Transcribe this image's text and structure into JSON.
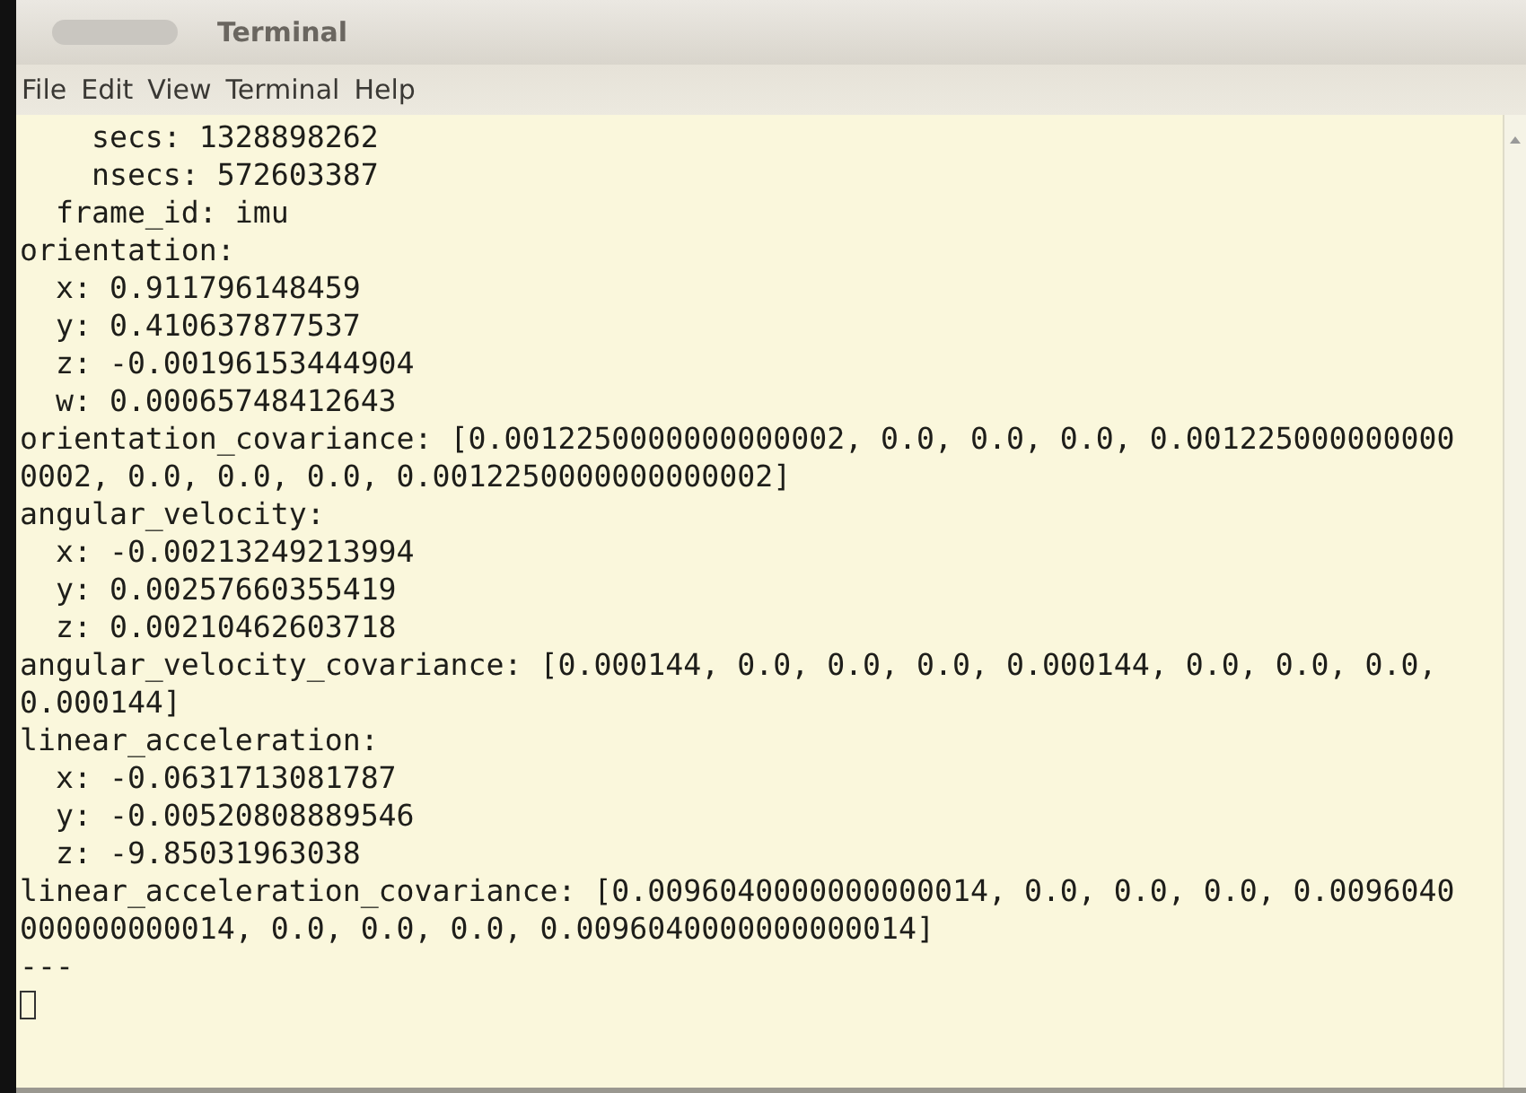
{
  "window": {
    "title": "Terminal"
  },
  "menu_bar": [
    "File",
    "Edit",
    "View",
    "Terminal",
    "Help"
  ],
  "terminal": {
    "lines": [
      "    secs: 1328898262",
      "    nsecs: 572603387",
      "  frame_id: imu",
      "orientation:",
      "  x: 0.911796148459",
      "  y: 0.410637877537",
      "  z: -0.00196153444904",
      "  w: 0.00065748412643",
      "orientation_covariance: [0.0012250000000000002, 0.0, 0.0, 0.0, 0.001225000000000",
      "0002, 0.0, 0.0, 0.0, 0.0012250000000000002]",
      "angular_velocity:",
      "  x: -0.00213249213994",
      "  y: 0.00257660355419",
      "  z: 0.00210462603718",
      "angular_velocity_covariance: [0.000144, 0.0, 0.0, 0.0, 0.000144, 0.0, 0.0, 0.0,",
      "0.000144]",
      "linear_acceleration:",
      "  x: -0.0631713081787",
      "  y: -0.00520808889546",
      "  z: -9.85031963038",
      "linear_acceleration_covariance: [0.0096040000000000014, 0.0, 0.0, 0.0, 0.0096040",
      "000000000014, 0.0, 0.0, 0.0, 0.0096040000000000014]",
      "---"
    ]
  }
}
